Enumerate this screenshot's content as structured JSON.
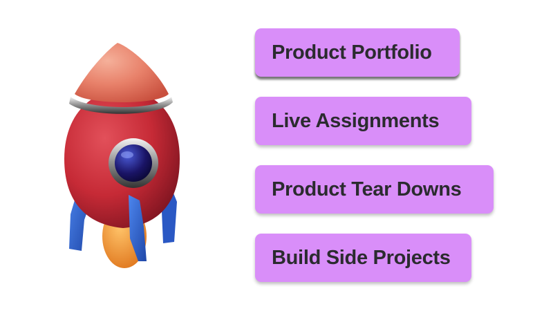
{
  "illustration": {
    "icon": "rocket-icon"
  },
  "colors": {
    "pill_background": "#d98ef9",
    "pill_text": "#2b2b2f",
    "rocket_body": "#c62a36",
    "rocket_nose": "#e8816a",
    "rocket_fins": "#2f66d6",
    "rocket_window": "#1a1466",
    "rocket_flame": "#f09a3a"
  },
  "items": [
    {
      "label": "Product Portfolio"
    },
    {
      "label": "Live Assignments"
    },
    {
      "label": "Product Tear Downs"
    },
    {
      "label": "Build Side Projects"
    }
  ]
}
